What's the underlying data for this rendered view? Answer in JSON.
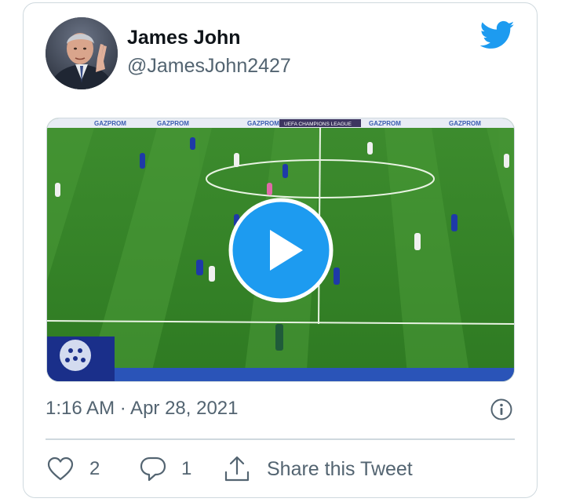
{
  "tweet": {
    "author_name": "James John",
    "author_handle": "@JamesJohn2427",
    "timestamp": "1:16 AM · Apr 28, 2021",
    "likes": "2",
    "replies": "1",
    "share_label": "Share this Tweet"
  },
  "media": {
    "banner_sponsor": "GAZPROM",
    "banner_league": "UEFA CHAMPIONS LEAGUE",
    "type": "video",
    "play_icon": "play-icon"
  },
  "colors": {
    "brand_blue": "#1d9bf0",
    "text_primary": "#0f1419",
    "text_secondary": "#536471",
    "border": "#cfd9de"
  },
  "icons": {
    "logo": "twitter-bird-icon",
    "like": "heart-icon",
    "reply": "reply-bubble-icon",
    "share": "share-upload-icon",
    "info": "info-icon"
  }
}
